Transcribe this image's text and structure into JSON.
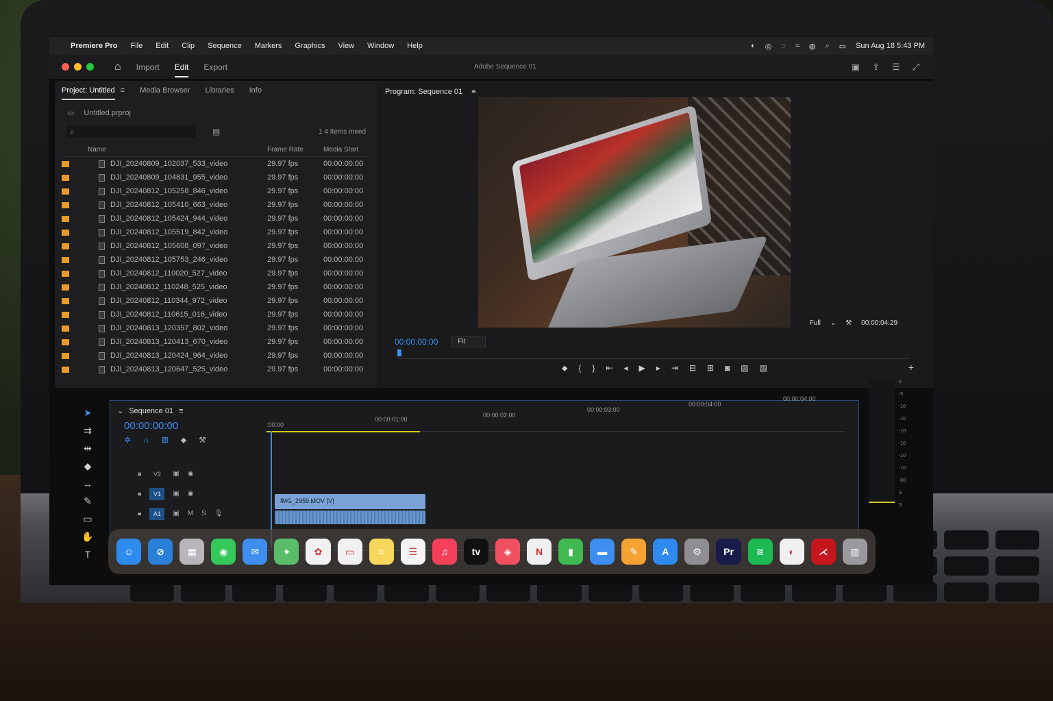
{
  "menubar": {
    "apple": "",
    "app_name": "Premiere Pro",
    "items": [
      "File",
      "Edit",
      "Clip",
      "Sequence",
      "Markers",
      "Graphics",
      "View",
      "Window",
      "Help"
    ],
    "datetime": "Sun Aug 18 5:43 PM"
  },
  "header": {
    "modes": [
      "Import",
      "Edit",
      "Export"
    ],
    "active_mode": "Edit",
    "sequence_title": "Adobe Sequence 01"
  },
  "project": {
    "tabs": [
      "Project: Untitled",
      "Media Browser",
      "Libraries",
      "Info"
    ],
    "file_name": "Untitled.prproj",
    "items_count": "1 4 Items meed",
    "columns": [
      "Name",
      "Frame Rate",
      "Media Start"
    ],
    "rows": [
      {
        "name": "DJI_20240809_102037_533_video",
        "fps": "29.97 fps",
        "start": "00:00:00:00"
      },
      {
        "name": "DJI_20240809_104831_955_video",
        "fps": "29.97 fps",
        "start": "00:00:00:00"
      },
      {
        "name": "DJI_20240812_105258_846_video",
        "fps": "29.97 fps",
        "start": "00:00:00:00"
      },
      {
        "name": "DJI_20240812_105410_663_video",
        "fps": "29.97 fps",
        "start": "00:00:00:00"
      },
      {
        "name": "DJI_20240812_105424_944_video",
        "fps": "29.97 fps",
        "start": "00:00:00:00"
      },
      {
        "name": "DJI_20240812_105519_842_video",
        "fps": "29.97 fps",
        "start": "00:00:00:00"
      },
      {
        "name": "DJI_20240812_105608_097_video",
        "fps": "29.97 fps",
        "start": "00:00:00:00"
      },
      {
        "name": "DJI_20240812_105753_246_video",
        "fps": "29.97 fps",
        "start": "00:00:00:00"
      },
      {
        "name": "DJI_20240812_110020_527_video",
        "fps": "29.97 fps",
        "start": "00:00:00:00"
      },
      {
        "name": "DJI_20240812_110248_525_video",
        "fps": "29.97 fps",
        "start": "00:00:00:00"
      },
      {
        "name": "DJI_20240812_110344_972_video",
        "fps": "29.97 fps",
        "start": "00:00:00:00"
      },
      {
        "name": "DJI_20240812_110615_016_video",
        "fps": "29.97 fps",
        "start": "00:00:00:00"
      },
      {
        "name": "DJI_20240813_120357_802_video",
        "fps": "29.97 fps",
        "start": "00:00:00:00"
      },
      {
        "name": "DJI_20240813_120413_670_video",
        "fps": "29.97 fps",
        "start": "00:00:00:00"
      },
      {
        "name": "DJI_20240813_120424_964_video",
        "fps": "29.97 fps",
        "start": "00:00:00:00"
      },
      {
        "name": "DJI_20240813_120647_525_video",
        "fps": "29.97 fps",
        "start": "00:00:00:00"
      }
    ]
  },
  "program": {
    "tab": "Program: Sequence 01",
    "timecode": "00:00:00:00",
    "fit": "Fit",
    "quality": "Full",
    "duration": "00:00:04:29"
  },
  "timeline": {
    "sequence_name": "Sequence 01",
    "timecode": "00:00:00:00",
    "ruler": [
      ":00:00",
      "00:00:01:00",
      "00:00:02:00",
      "00:00:03:00",
      "00:00:04:00",
      "00:00:04:00"
    ],
    "tracks": [
      {
        "tag": "V2",
        "on": false
      },
      {
        "tag": "V1",
        "on": true
      },
      {
        "tag": "A1",
        "on": true
      }
    ],
    "track_m": "M",
    "track_s": "S",
    "clip_label": "IMG_2959.MOV [V]"
  },
  "meter": {
    "scale": [
      "0",
      "-5",
      "-10",
      "-10",
      "-10",
      "-10",
      "-10",
      "-10",
      "-00"
    ],
    "footer": [
      "S",
      "S"
    ]
  },
  "dock": {
    "icons": [
      {
        "name": "finder",
        "color": "#2e8cf0",
        "glyph": "☺"
      },
      {
        "name": "safari",
        "color": "#2a7fd8",
        "glyph": "⊘"
      },
      {
        "name": "launchpad",
        "color": "#b6b6bb",
        "glyph": "▦"
      },
      {
        "name": "messages",
        "color": "#34c759",
        "glyph": "◉"
      },
      {
        "name": "mail",
        "color": "#3d8ef0",
        "glyph": "✉"
      },
      {
        "name": "maps",
        "color": "#5bbd6a",
        "glyph": "⌖"
      },
      {
        "name": "photos",
        "color": "#f1f1f1",
        "glyph": "✿"
      },
      {
        "name": "calendar",
        "color": "#f1f1f1",
        "glyph": "▭"
      },
      {
        "name": "notes",
        "color": "#f6d65b",
        "glyph": "≡"
      },
      {
        "name": "reminders",
        "color": "#f4f4f4",
        "glyph": "☰"
      },
      {
        "name": "music",
        "color": "#f5405a",
        "glyph": "♫"
      },
      {
        "name": "apple-tv",
        "color": "#111111",
        "glyph": "tv"
      },
      {
        "name": "news-reader",
        "color": "#f05060",
        "glyph": "◈"
      },
      {
        "name": "news",
        "color": "#f0f0f0",
        "glyph": "N"
      },
      {
        "name": "numbers",
        "color": "#3fb950",
        "glyph": "▮"
      },
      {
        "name": "keynote",
        "color": "#3d8ef0",
        "glyph": "▬"
      },
      {
        "name": "pages",
        "color": "#f4a234",
        "glyph": "✎"
      },
      {
        "name": "app-store",
        "color": "#2f8af0",
        "glyph": "A"
      },
      {
        "name": "system-settings",
        "color": "#8e8e93",
        "glyph": "⚙"
      },
      {
        "name": "premiere-pro",
        "color": "#1a1a4a",
        "glyph": "Pr"
      },
      {
        "name": "spotify",
        "color": "#1db954",
        "glyph": "≋"
      },
      {
        "name": "chrome",
        "color": "#f0f0f0",
        "glyph": "◐"
      },
      {
        "name": "acrobat",
        "color": "#c4161c",
        "glyph": "⋌"
      },
      {
        "name": "trash",
        "color": "#9a9a9e",
        "glyph": "▥"
      }
    ]
  }
}
